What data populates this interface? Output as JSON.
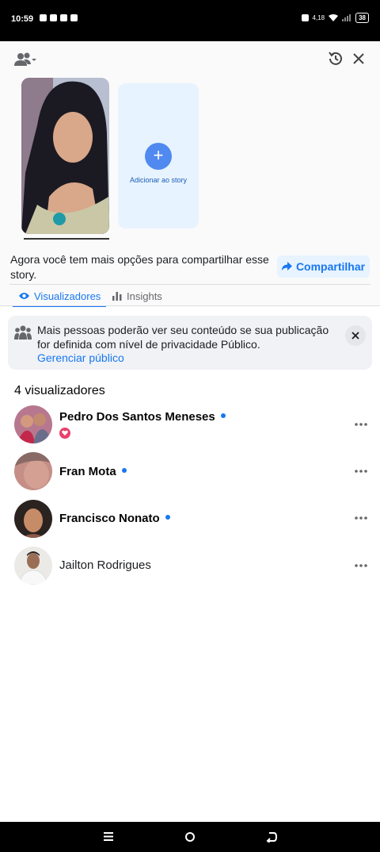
{
  "status_bar": {
    "time": "10:59",
    "battery": "38",
    "network": "4,18"
  },
  "story": {
    "add_label": "Adicionar ao story"
  },
  "share": {
    "text": "Agora você tem mais opções para compartilhar esse story.",
    "button_label": "Compartilhar"
  },
  "tabs": {
    "viewers": "Visualizadores",
    "insights": "Insights"
  },
  "notice": {
    "text": "Mais pessoas poderão ver seu conteúdo se sua publicação for definida com nível de privacidade Público.",
    "link": "Gerenciar público"
  },
  "viewers_count": "4 visualizadores",
  "viewers": [
    {
      "name": "Pedro Dos Santos Meneses",
      "online": true,
      "reaction": "heart"
    },
    {
      "name": "Fran Mota",
      "online": true
    },
    {
      "name": "Francisco Nonato",
      "online": true
    },
    {
      "name": "Jailton Rodrigues",
      "online": false
    }
  ],
  "colors": {
    "accent": "#1877f2",
    "share_bg": "#e7f3ff",
    "notice_bg": "#f0f2f5",
    "reaction": "#e9406a"
  },
  "icons": {
    "top_left": "friends-icon",
    "top_right": [
      "history-icon",
      "close-icon"
    ],
    "notice": "people-group-icon",
    "row_action": "more-icon"
  }
}
